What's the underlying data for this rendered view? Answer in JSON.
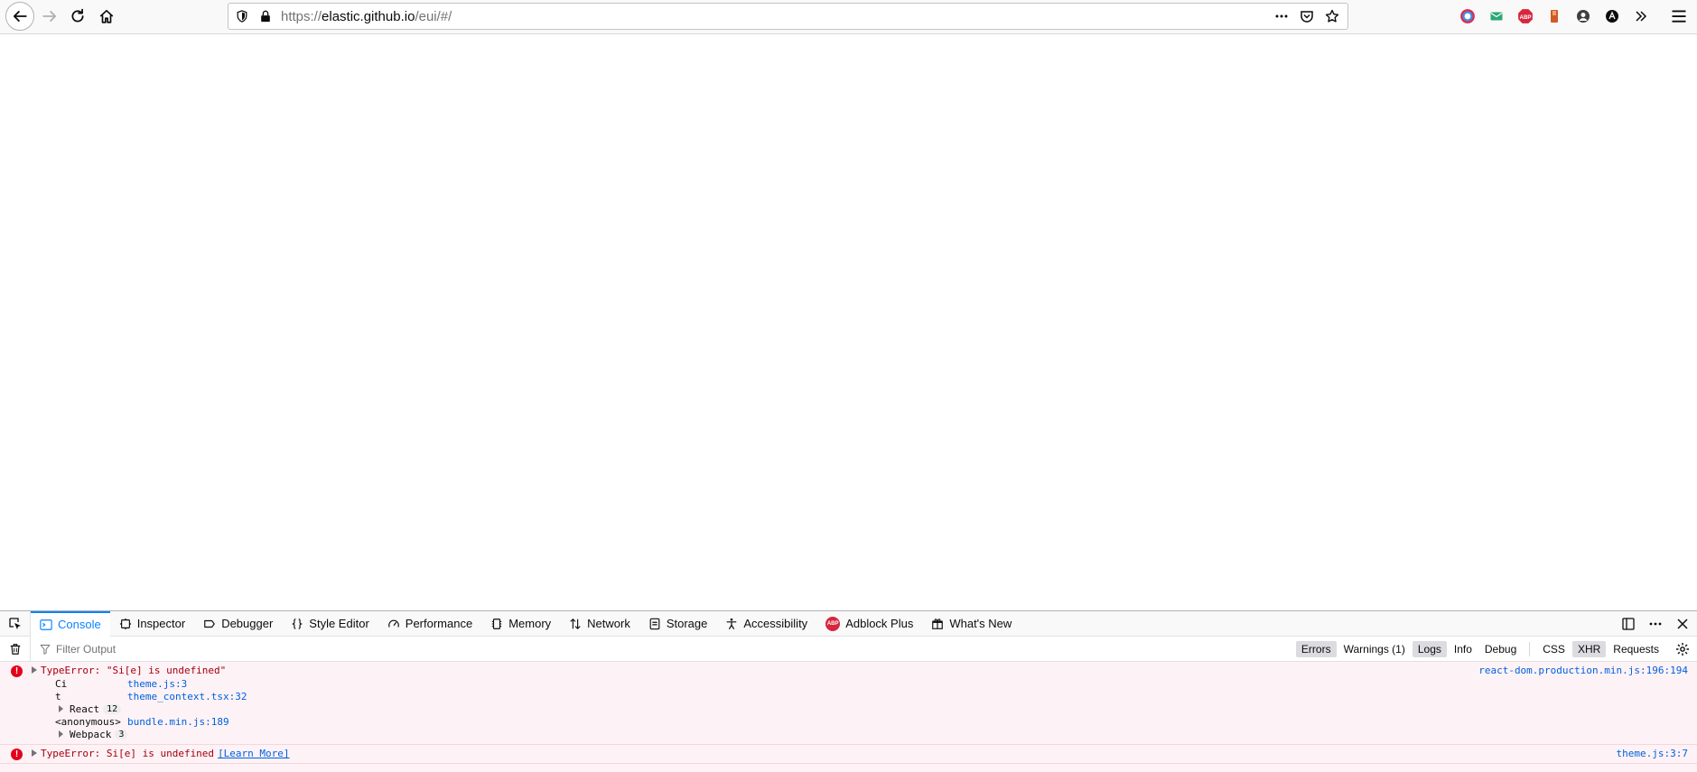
{
  "browser": {
    "url_prefix": "https://",
    "url_host": "elastic.github.io",
    "url_path": "/eui/#/",
    "page_actions": [
      "more-icon",
      "pocket-icon",
      "bookmark-star-icon"
    ],
    "extensions": [
      "color-picker-ext-icon",
      "mail-ext-icon",
      "adblock-plus-ext-icon",
      "bookmark-ext-icon",
      "account-ext-icon",
      "dark-mode-ext-icon",
      "overflow-chevron-icon"
    ],
    "abp_text": "ABP"
  },
  "devtools": {
    "tabs": [
      {
        "label": "Console",
        "icon": "console-icon",
        "active": true
      },
      {
        "label": "Inspector",
        "icon": "inspector-icon"
      },
      {
        "label": "Debugger",
        "icon": "debugger-icon"
      },
      {
        "label": "Style Editor",
        "icon": "style-editor-icon"
      },
      {
        "label": "Performance",
        "icon": "performance-icon"
      },
      {
        "label": "Memory",
        "icon": "memory-icon"
      },
      {
        "label": "Network",
        "icon": "network-icon"
      },
      {
        "label": "Storage",
        "icon": "storage-icon"
      },
      {
        "label": "Accessibility",
        "icon": "accessibility-icon"
      },
      {
        "label": "Adblock Plus",
        "icon": "adblock-plus-icon"
      },
      {
        "label": "What's New",
        "icon": "gift-icon"
      }
    ],
    "filter": {
      "placeholder": "Filter Output",
      "buttons": {
        "errors": "Errors",
        "warnings": "Warnings (1)",
        "logs": "Logs",
        "info": "Info",
        "debug": "Debug",
        "css": "CSS",
        "xhr": "XHR",
        "requests": "Requests"
      }
    },
    "messages": [
      {
        "text": "TypeError: \"Si[e] is undefined\"",
        "source": "react-dom.production.min.js:196:194",
        "frames": [
          {
            "fn": "Ci",
            "loc": "theme.js:3"
          },
          {
            "fn": "t",
            "loc": "theme_context.tsx:32"
          }
        ],
        "group1": {
          "name": "React",
          "count": "12"
        },
        "frame3": {
          "fn": "<anonymous>",
          "loc": "bundle.min.js:189"
        },
        "group2": {
          "name": "Webpack",
          "count": "3"
        }
      },
      {
        "text": "TypeError: Si[e] is undefined",
        "learn_more": "[Learn More]",
        "source": "theme.js:3:7"
      }
    ]
  }
}
